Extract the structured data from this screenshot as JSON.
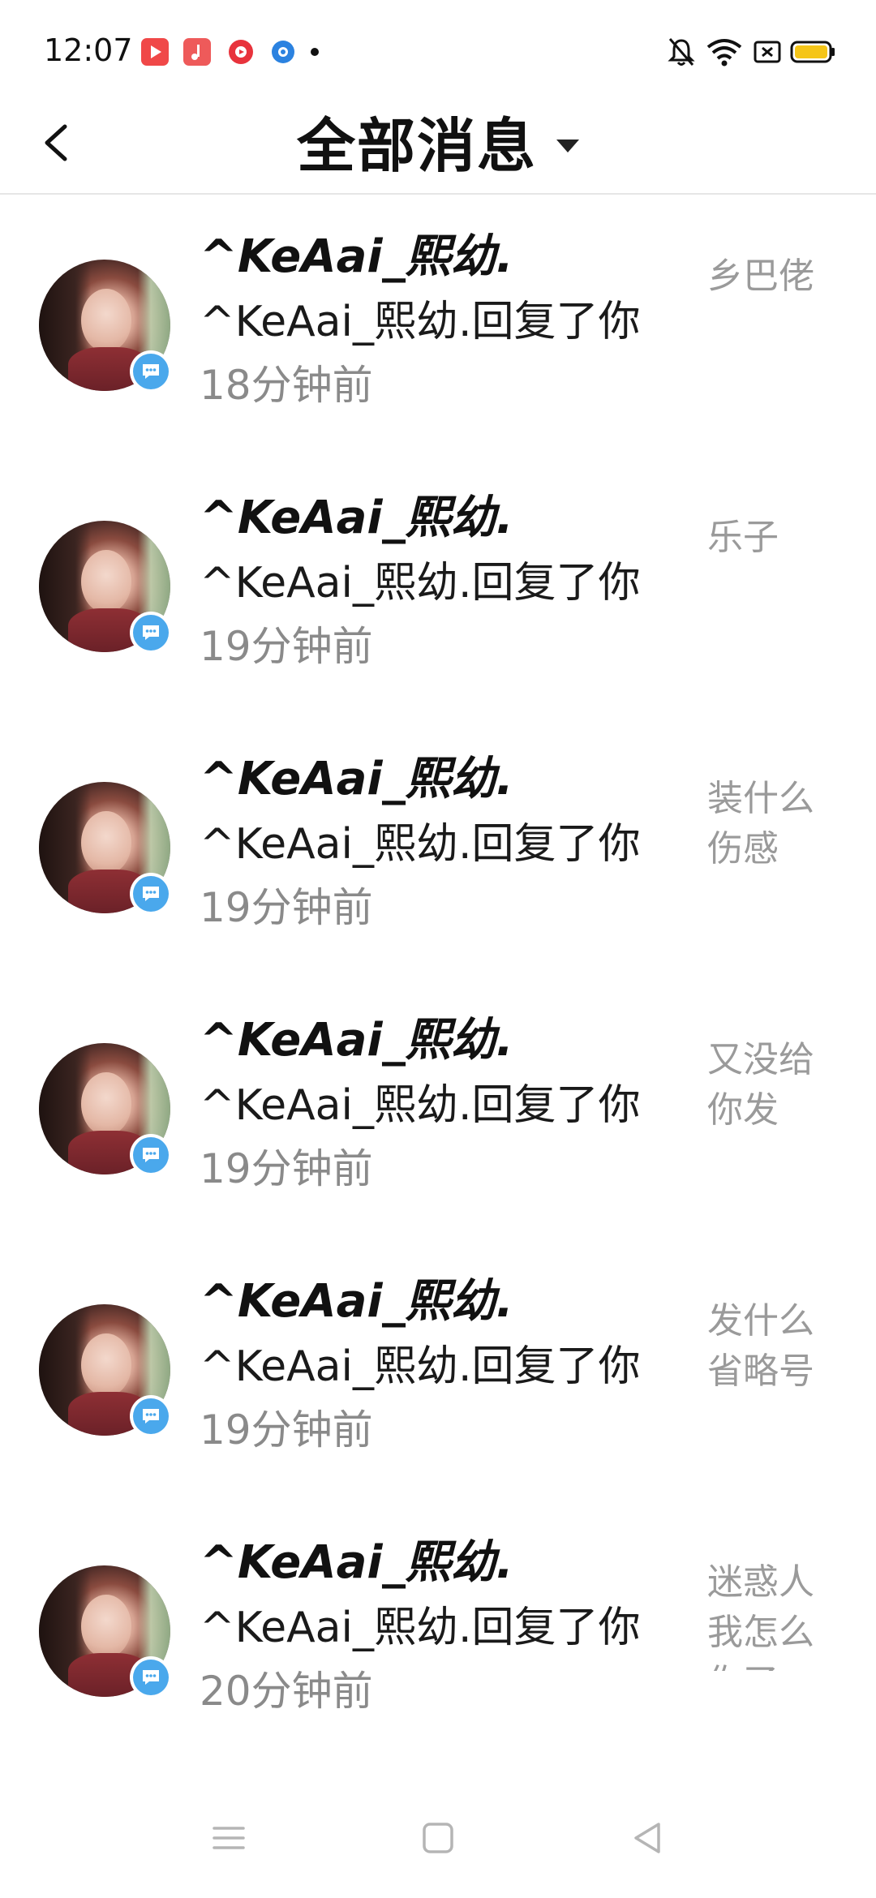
{
  "status_bar": {
    "time": "12:07",
    "app_icons": [
      {
        "name": "video-app-icon",
        "color": "#f04848"
      },
      {
        "name": "music-app-icon",
        "color": "#ee5a5a"
      },
      {
        "name": "player-app-icon",
        "color": "#e8333c"
      },
      {
        "name": "browser-app-icon",
        "color": "#2b82e0"
      }
    ],
    "battery_color": "#f5c518"
  },
  "header": {
    "title": "全部消息"
  },
  "messages": [
    {
      "name": "^KeAai_熙幼.",
      "text": "^KeAai_熙幼.回复了你",
      "time": "18分钟前",
      "quote": "乡巴佬"
    },
    {
      "name": "^KeAai_熙幼.",
      "text": "^KeAai_熙幼.回复了你",
      "time": "19分钟前",
      "quote": "乐子"
    },
    {
      "name": "^KeAai_熙幼.",
      "text": "^KeAai_熙幼.回复了你",
      "time": "19分钟前",
      "quote": "装什么伤感"
    },
    {
      "name": "^KeAai_熙幼.",
      "text": "^KeAai_熙幼.回复了你",
      "time": "19分钟前",
      "quote": "又没给你发"
    },
    {
      "name": "^KeAai_熙幼.",
      "text": "^KeAai_熙幼.回复了你",
      "time": "19分钟前",
      "quote": "发什么省略号"
    },
    {
      "name": "^KeAai_熙幼.",
      "text": "^KeAai_熙幼.回复了你",
      "time": "20分钟前",
      "quote": "迷惑人我怎么你了"
    }
  ],
  "colors": {
    "accent_badge": "#4aa8ec",
    "secondary_text": "#8a8a8a",
    "quote_text": "#9a9a9a"
  }
}
